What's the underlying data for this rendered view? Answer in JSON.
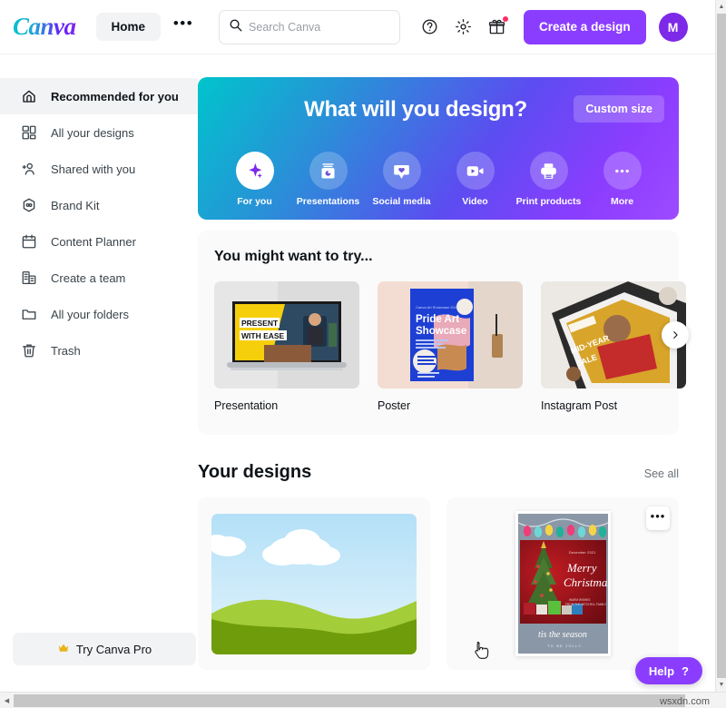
{
  "header": {
    "logo_text": "Canva",
    "home_label": "Home",
    "more_label": "•••",
    "search_placeholder": "Search Canva",
    "search_value": "",
    "help_icon": "question-circle-icon",
    "settings_icon": "gear-icon",
    "gift_icon": "gift-icon",
    "create_label": "Create a design",
    "avatar_initial": "M"
  },
  "sidebar": {
    "items": [
      {
        "label": "Recommended for you",
        "icon": "home-icon",
        "active": true
      },
      {
        "label": "All your designs",
        "icon": "grid-icon",
        "active": false
      },
      {
        "label": "Shared with you",
        "icon": "add-person-icon",
        "active": false
      },
      {
        "label": "Brand Kit",
        "icon": "hexagon-icon",
        "active": false
      },
      {
        "label": "Content Planner",
        "icon": "calendar-icon",
        "active": false
      },
      {
        "label": "Create a team",
        "icon": "building-icon",
        "active": false
      },
      {
        "label": "All your folders",
        "icon": "folder-icon",
        "active": false
      },
      {
        "label": "Trash",
        "icon": "trash-icon",
        "active": false
      }
    ],
    "pro_button_label": "Try Canva Pro",
    "pro_button_icon": "crown-icon"
  },
  "hero": {
    "title": "What will you design?",
    "custom_size_label": "Custom size",
    "categories": [
      {
        "label": "For you",
        "icon": "sparkle-icon",
        "selected": true
      },
      {
        "label": "Presentations",
        "icon": "presentation-icon",
        "selected": false
      },
      {
        "label": "Social media",
        "icon": "chat-heart-icon",
        "selected": false
      },
      {
        "label": "Video",
        "icon": "video-camera-icon",
        "selected": false
      },
      {
        "label": "Print products",
        "icon": "printer-icon",
        "selected": false
      },
      {
        "label": "More",
        "icon": "ellipsis-icon",
        "selected": false
      }
    ]
  },
  "try_section": {
    "title": "You might want to try...",
    "next_arrow_icon": "chevron-right-icon",
    "cards": [
      {
        "label": "Presentation",
        "thumb_title": "PRESENT WITH EASE"
      },
      {
        "label": "Poster",
        "thumb_title": "Pride Art Showcase"
      },
      {
        "label": "Instagram Post",
        "thumb_title": "MID-YEAR SALE"
      }
    ]
  },
  "designs_section": {
    "title": "Your designs",
    "see_all_label": "See all",
    "cards": [
      {
        "name": "landscape-design",
        "more_icon": null
      },
      {
        "name": "christmas-card-design",
        "more_icon": "ellipsis-icon",
        "card_date": "December 2021",
        "card_greeting_line1": "Merry",
        "card_greeting_line2": "Christmas!",
        "card_wishes_line1": "WARM WISHES",
        "card_wishes_line2": "FROM THE MITCHELL FAMILY",
        "card_footer_line1": "tis the season",
        "card_footer_line2": "TO BE JOLLY"
      }
    ]
  },
  "help": {
    "label": "Help",
    "mark": "?"
  },
  "watermark": "wsxdn.com",
  "colors": {
    "brand_purple": "#8b3dff",
    "accent_teal": "#00c4cc",
    "notification_red": "#ff2e63",
    "panel_gray": "#fafafa"
  }
}
